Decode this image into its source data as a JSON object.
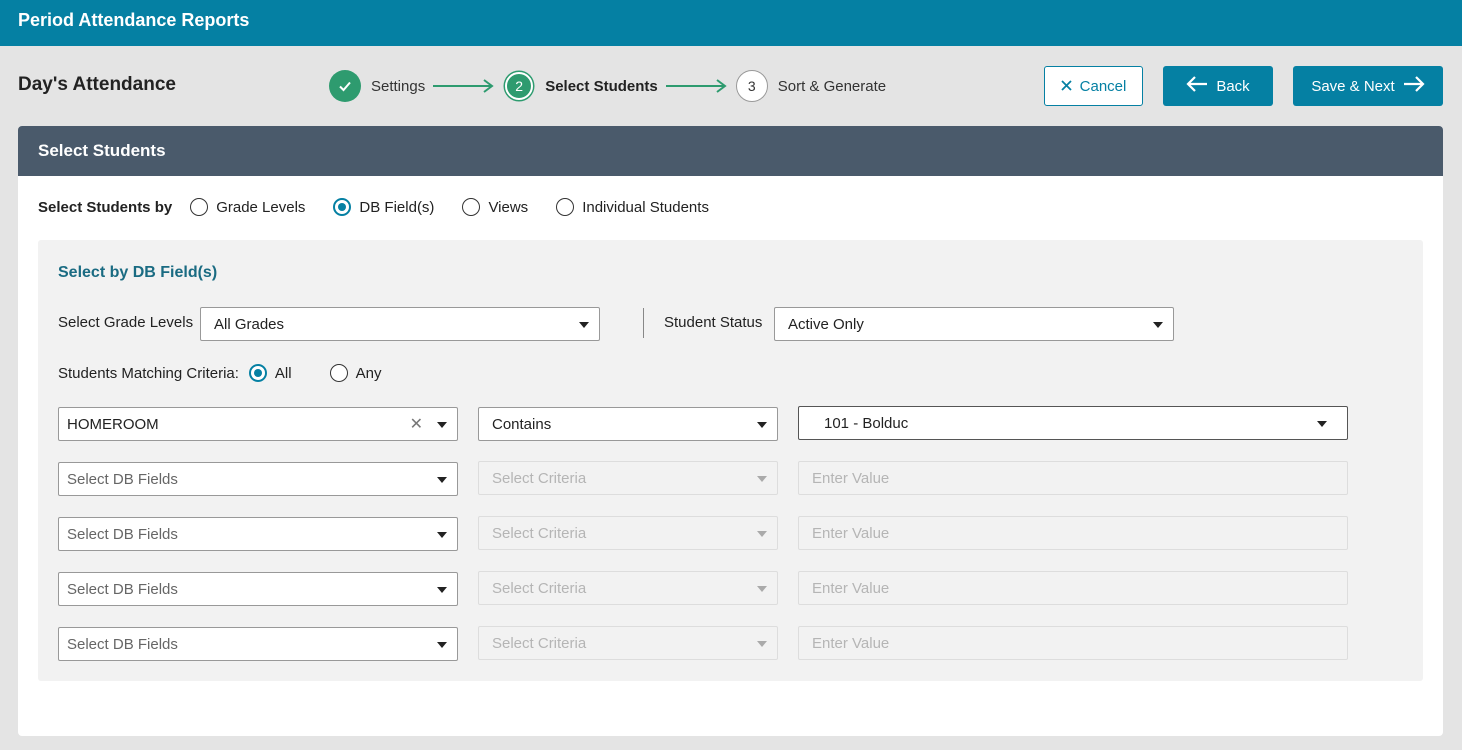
{
  "app": {
    "title": "Period Attendance Reports"
  },
  "page": {
    "title": "Day's Attendance"
  },
  "stepper": {
    "steps": [
      {
        "number": "1",
        "label": "Settings",
        "state": "done"
      },
      {
        "number": "2",
        "label": "Select Students",
        "state": "active"
      },
      {
        "number": "3",
        "label": "Sort & Generate",
        "state": "todo"
      }
    ]
  },
  "actions": {
    "cancel": "Cancel",
    "back": "Back",
    "next": "Save & Next"
  },
  "card": {
    "title": "Select Students"
  },
  "select_by": {
    "label": "Select Students by",
    "options": [
      "Grade Levels",
      "DB Field(s)",
      "Views",
      "Individual Students"
    ],
    "selected": "DB Field(s)"
  },
  "db_panel": {
    "title": "Select by DB Field(s)",
    "grade_label": "Select Grade Levels",
    "grade_value": "All Grades",
    "status_label": "Student Status",
    "status_value": "Active Only",
    "match_label": "Students Matching Criteria:",
    "match_options": [
      "All",
      "Any"
    ],
    "match_selected": "All",
    "rows": [
      {
        "field": "HOMEROOM",
        "criteria": "Contains",
        "value": "101 - Bolduc",
        "enabled": true
      },
      {
        "field": "Select DB Fields",
        "criteria": "Select Criteria",
        "value": "Enter Value",
        "enabled": false
      },
      {
        "field": "Select DB Fields",
        "criteria": "Select Criteria",
        "value": "Enter Value",
        "enabled": false
      },
      {
        "field": "Select DB Fields",
        "criteria": "Select Criteria",
        "value": "Enter Value",
        "enabled": false
      },
      {
        "field": "Select DB Fields",
        "criteria": "Select Criteria",
        "value": "Enter Value",
        "enabled": false
      }
    ]
  },
  "colors": {
    "primary": "#0580a3",
    "success": "#2e9b6f",
    "header_dark": "#4a5a6b"
  }
}
